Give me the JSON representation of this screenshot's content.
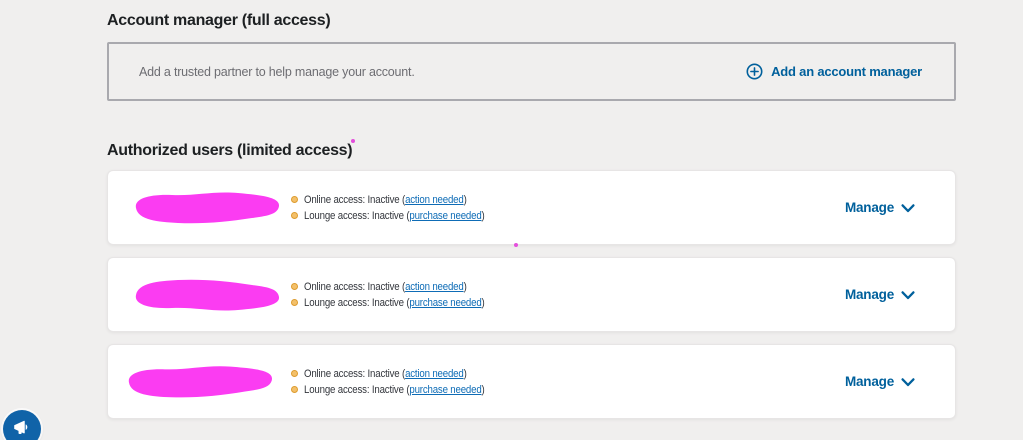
{
  "colors": {
    "page_bg": "#f0efee",
    "accent_blue": "#00609c",
    "link_blue": "#0e6cb6",
    "status_dot_amber": "#ddA02f",
    "redaction_magenta": "#fb3cf2",
    "heading_text": "#1d2022",
    "muted_text": "#6d6d72"
  },
  "account_manager_section": {
    "heading": "Account manager (full access)",
    "panel_text": "Add a trusted partner to help manage your account.",
    "add_button_label": "Add an account manager",
    "add_button_icon": "plus-circle-icon"
  },
  "authorized_users_section": {
    "heading": "Authorized users (limited access)",
    "users": [
      {
        "statuses": [
          {
            "prefix": "Online access: Inactive (",
            "link": "action needed",
            "suffix": ")"
          },
          {
            "prefix": "Lounge access: Inactive (",
            "link": "purchase needed",
            "suffix": ")"
          }
        ],
        "manage_label": "Manage"
      },
      {
        "statuses": [
          {
            "prefix": "Online access: Inactive (",
            "link": "action needed",
            "suffix": ")"
          },
          {
            "prefix": "Lounge access: Inactive (",
            "link": "purchase needed",
            "suffix": ")"
          }
        ],
        "manage_label": "Manage"
      },
      {
        "statuses": [
          {
            "prefix": "Online access: Inactive (",
            "link": "action needed",
            "suffix": ")"
          },
          {
            "prefix": "Lounge access: Inactive (",
            "link": "purchase needed",
            "suffix": ")"
          }
        ],
        "manage_label": "Manage"
      }
    ]
  },
  "floating_widget": {
    "icon": "megaphone-icon"
  }
}
